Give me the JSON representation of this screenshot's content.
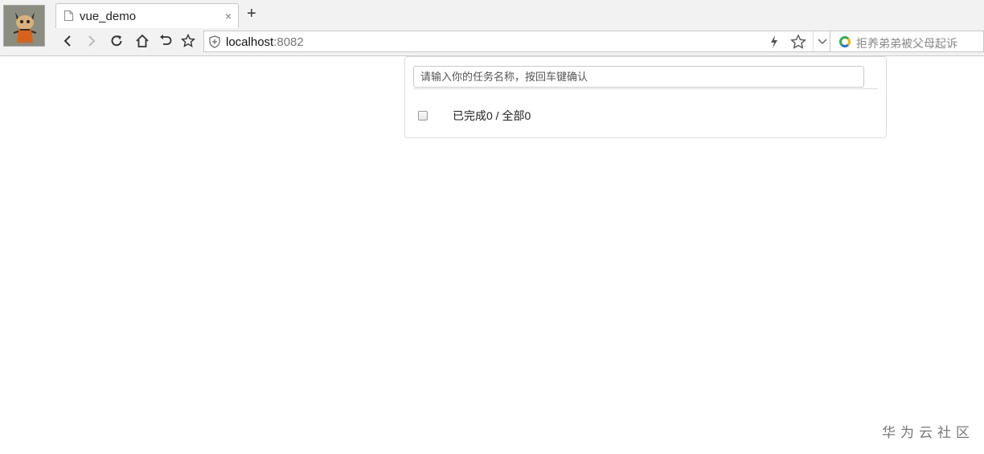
{
  "browser": {
    "tab": {
      "title": "vue_demo",
      "close_label": "×"
    },
    "new_tab_label": "+",
    "address": {
      "host": "localhost",
      "port": ":8082"
    },
    "search_hint": "拒养弟弟被父母起诉"
  },
  "app": {
    "input_placeholder": "请输入你的任务名称，按回车键确认",
    "input_value": "",
    "select_all_checked": false,
    "status": {
      "done_prefix": "已完成",
      "done_count": "0",
      "separator": " / ",
      "all_prefix": "全部",
      "all_count": "0"
    }
  },
  "watermark": "华为云社区"
}
